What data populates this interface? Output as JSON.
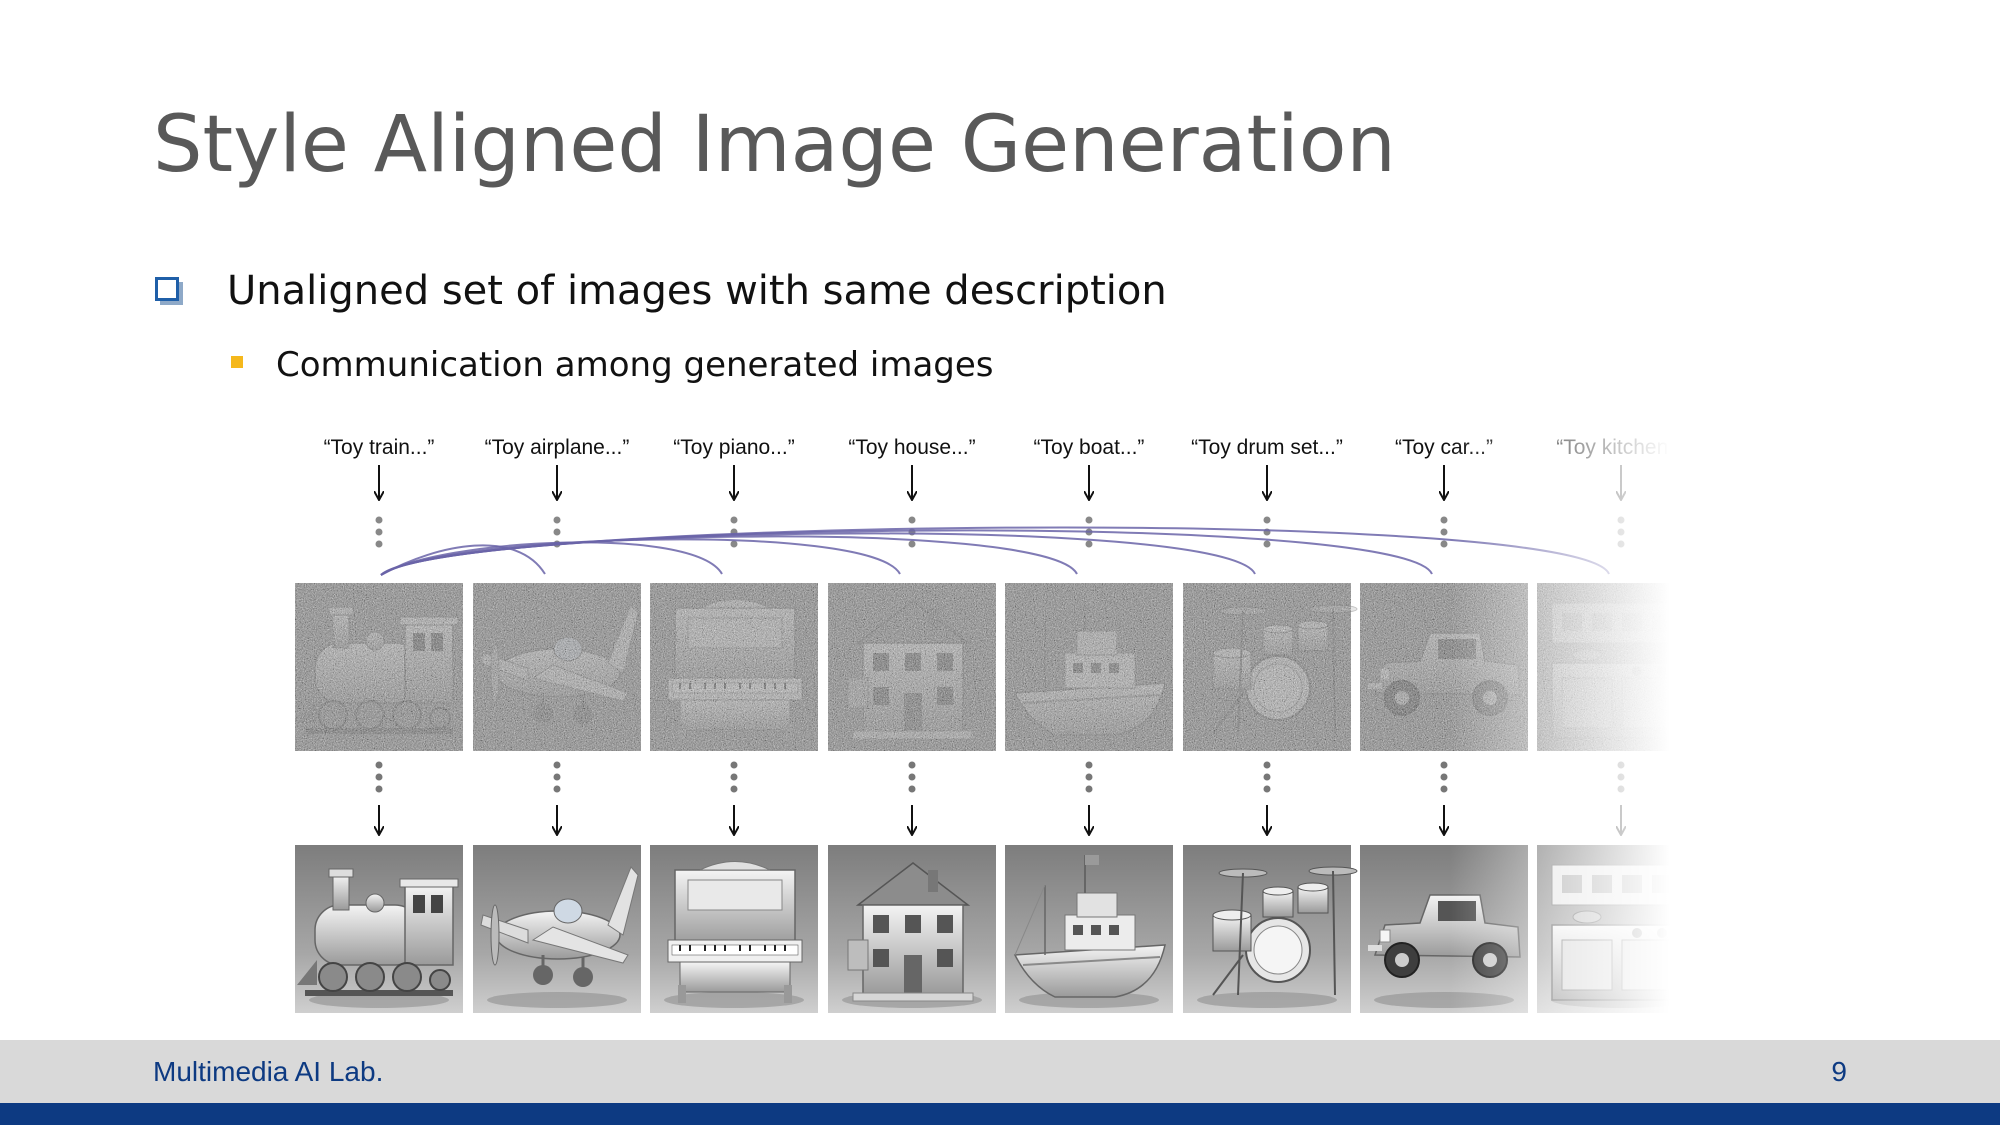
{
  "slide": {
    "title": "Style Aligned Image Generation",
    "bullet_1": "Unaligned set of images with same description",
    "bullet_2": "Communication among generated images"
  },
  "figure": {
    "prompts": [
      "“Toy train...”",
      "“Toy airplane...”",
      "“Toy piano...”",
      "“Toy house...”",
      "“Toy boat...”",
      "“Toy drum set...”",
      "“Toy car...”",
      "“Toy kitchen..."
    ],
    "objects": [
      "train",
      "airplane",
      "piano",
      "house",
      "boat",
      "drum-set",
      "car",
      "kitchen"
    ],
    "attention_color": "#6a64a8"
  },
  "footer": {
    "lab": "Multimedia AI Lab.",
    "page_number": "9"
  },
  "colors": {
    "title": "#595959",
    "footer_text": "#0d3a82",
    "footer_bar": "#d9d9d9",
    "bottom_stripe": "#0d3a82",
    "bullet_square": "#f5b81c",
    "checkbox": "#1f5fa8"
  }
}
